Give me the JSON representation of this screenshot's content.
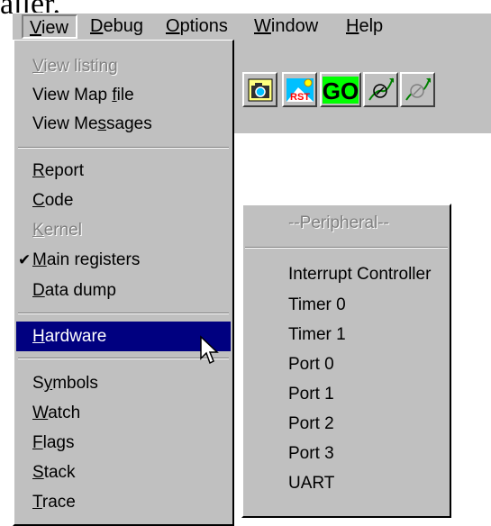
{
  "top_fragment": "aller.",
  "menubar": [
    {
      "label": "View",
      "accel": "V",
      "rest": "iew"
    },
    {
      "label": "Debug",
      "accel": "D",
      "rest": "ebug"
    },
    {
      "label": "Options",
      "accel": "O",
      "rest": "ptions"
    },
    {
      "label": "Window",
      "accel": "W",
      "rest": "indow"
    },
    {
      "label": "Help",
      "accel": "H",
      "rest": "elp"
    }
  ],
  "toolbar": {
    "buttons": [
      {
        "name": "camera-icon"
      },
      {
        "name": "reset-icon",
        "label": "RST"
      },
      {
        "name": "go-icon",
        "label": "GO"
      },
      {
        "name": "step-icon"
      },
      {
        "name": "step-over-icon"
      }
    ]
  },
  "view_menu": {
    "items": [
      {
        "pre": "",
        "accel": "V",
        "post": "iew listing",
        "disabled": true
      },
      {
        "pre": "View Map ",
        "accel": "f",
        "post": "ile",
        "disabled": false
      },
      {
        "pre": "View Me",
        "accel": "s",
        "post": "sages",
        "disabled": false
      },
      {
        "pre": "",
        "accel": "R",
        "post": "eport",
        "disabled": false
      },
      {
        "pre": "",
        "accel": "C",
        "post": "ode",
        "disabled": false
      },
      {
        "pre": "",
        "accel": "K",
        "post": "ernel",
        "disabled": true
      },
      {
        "pre": "",
        "accel": "M",
        "post": "ain registers",
        "disabled": false,
        "checked": true
      },
      {
        "pre": "",
        "accel": "D",
        "post": "ata dump",
        "disabled": false
      },
      {
        "pre": "",
        "accel": "H",
        "post": "ardware",
        "disabled": false,
        "highlighted": true
      },
      {
        "pre": "S",
        "accel": "y",
        "post": "mbols",
        "disabled": false
      },
      {
        "pre": "",
        "accel": "W",
        "post": "atch",
        "disabled": false
      },
      {
        "pre": "",
        "accel": "F",
        "post": "lags",
        "disabled": false
      },
      {
        "pre": "",
        "accel": "S",
        "post": "tack",
        "disabled": false
      },
      {
        "pre": "",
        "accel": "T",
        "post": "race",
        "disabled": false
      }
    ],
    "check_mark": "✔"
  },
  "hardware_submenu": {
    "header": "--Peripheral--",
    "items": [
      "Interrupt Controller",
      "Timer 0",
      "Timer 1",
      "Port 0",
      "Port 1",
      "Port 2",
      "Port 3",
      "UART"
    ]
  }
}
